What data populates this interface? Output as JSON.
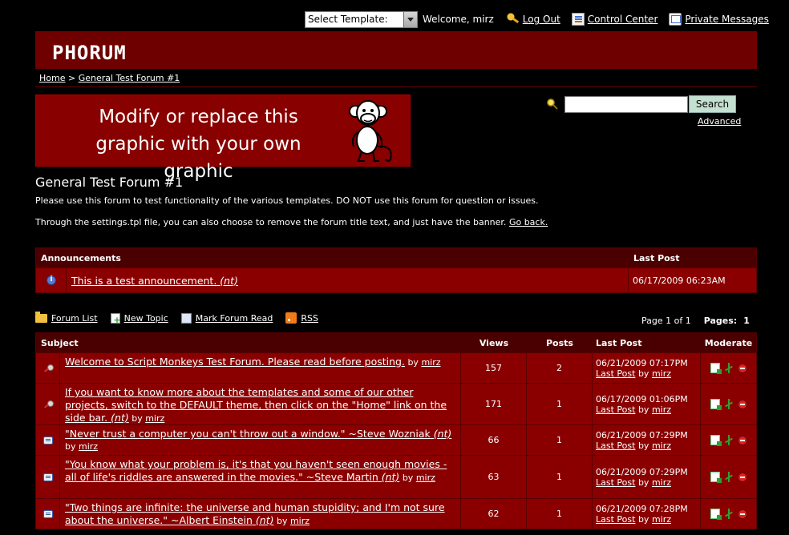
{
  "topbar": {
    "template_select": "Select Template:",
    "welcome": "Welcome, mirz",
    "logout": "Log Out",
    "control_center": "Control Center",
    "private_messages": "Private Messages"
  },
  "header": {
    "logo": "PHORUM"
  },
  "breadcrumb": {
    "home": "Home",
    "separator": ">",
    "forum": "General Test Forum #1"
  },
  "banner": {
    "line1": "Modify or replace this",
    "line2": "graphic with your own graphic"
  },
  "search": {
    "button": "Search",
    "advanced": "Advanced",
    "value": ""
  },
  "forum": {
    "title": "General Test Forum #1",
    "description": "Please use this forum to test functionality of the various templates. DO NOT use this forum for question or issues.",
    "note_text": "Through the settings.tpl file, you can also choose to remove the forum title text, and just have the banner.",
    "go_back": "Go back."
  },
  "announcements": {
    "header": "Announcements",
    "last_post_header": "Last Post",
    "items": [
      {
        "title": "This is a test announcement.",
        "nt": "(nt)",
        "date": "06/17/2009 06:23AM"
      }
    ]
  },
  "nav": {
    "forum_list": "Forum List",
    "new_topic": "New Topic",
    "mark_read": "Mark Forum Read",
    "rss": "RSS",
    "page_info": "Page 1 of 1",
    "pages_label": "Pages:",
    "page_number": "1"
  },
  "list": {
    "headers": {
      "subject": "Subject",
      "views": "Views",
      "posts": "Posts",
      "last_post": "Last Post",
      "moderate": "Moderate"
    },
    "by": "by",
    "last_post_link": "Last Post",
    "rows": [
      {
        "type": "sticky",
        "title": "Welcome to Script Monkeys Test Forum. Please read before posting.",
        "nt": "",
        "author": "mirz",
        "views": "157",
        "posts": "2",
        "date": "06/21/2009 07:17PM",
        "last_author": "mirz"
      },
      {
        "type": "sticky",
        "title": "If you want to know more about the templates and some of our other projects, switch to the DEFAULT theme, then click on the \"Home\" link on the side bar.",
        "nt": "(nt)",
        "author": "mirz",
        "views": "171",
        "posts": "1",
        "date": "06/17/2009 01:06PM",
        "last_author": "mirz"
      },
      {
        "type": "message",
        "title": "\"Never trust a computer you can't throw out a window.\" ~Steve Wozniak",
        "nt": "(nt)",
        "author": "mirz",
        "views": "66",
        "posts": "1",
        "date": "06/21/2009 07:29PM",
        "last_author": "mirz"
      },
      {
        "type": "message",
        "title": "\"You know what your problem is, it's that you haven't seen enough movies - all of life's riddles are answered in the movies.\" ~Steve Martin",
        "nt": "(nt)",
        "author": "mirz",
        "views": "63",
        "posts": "1",
        "date": "06/21/2009 07:29PM",
        "last_author": "mirz"
      },
      {
        "type": "message",
        "title": "\"Two things are infinite: the universe and human stupidity; and I'm not sure about the universe.\" ~Albert Einstein",
        "nt": "(nt)",
        "author": "mirz",
        "views": "62",
        "posts": "1",
        "date": "06/21/2009 07:28PM",
        "last_author": "mirz"
      }
    ]
  }
}
